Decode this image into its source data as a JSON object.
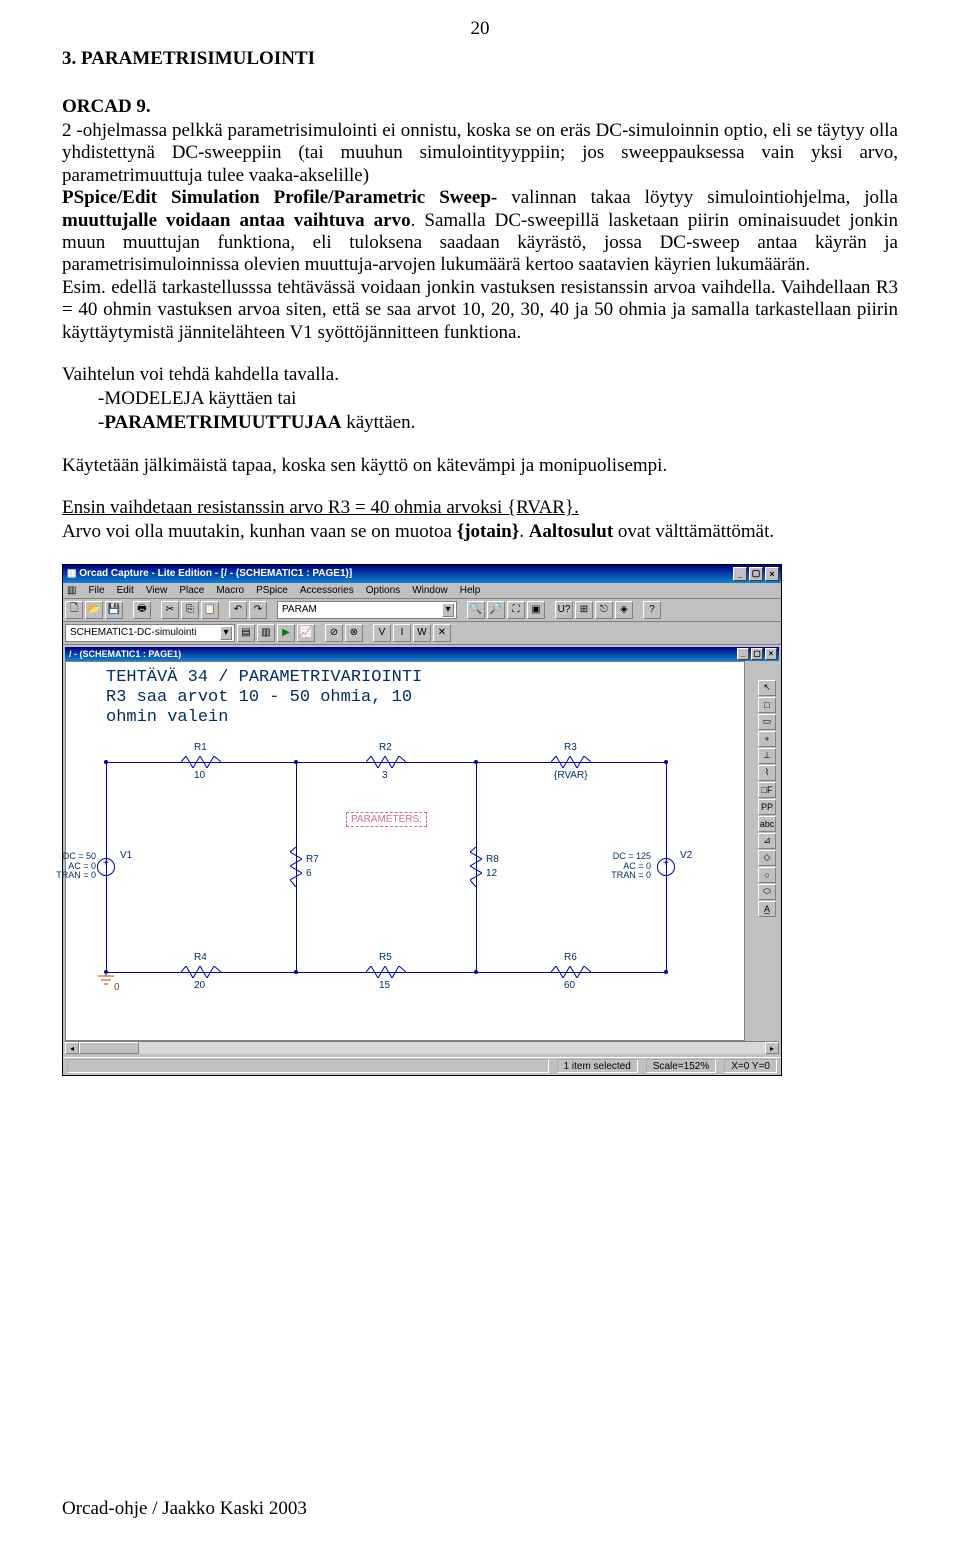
{
  "page_number": "20",
  "heading": "3. PARAMETRISIMULOINTI",
  "subheading": "ORCAD 9.",
  "para1_run1": "2 -ohjelmassa pelkkä parametrisimulointi ei onnistu, koska se on eräs DC-simuloinnin optio, eli se täytyy olla yhdistettynä DC-sweeppiin (tai muuhun simulointityyppiin; jos sweeppauksessa vain yksi arvo, parametrimuuttuja tulee vaaka-akselille)",
  "para1_run2_bold": "PSpice/Edit Simulation Profile/Parametric Sweep-",
  "para1_run3": " valinnan takaa löytyy simulointiohjelma, jolla ",
  "para1_run4_bold": "muuttujalle voidaan antaa vaihtuva arvo",
  "para1_run5": ". Samalla DC-sweepillä lasketaan piirin ominaisuudet jonkin muun muuttujan funktiona, eli tuloksena saadaan käyrästö, jossa DC-sweep antaa käyrän ja parametrisimuloinnissa olevien muuttuja-arvojen lukumäärä kertoo saatavien käyrien lukumäärän.",
  "para1_run6": "Esim. edellä tarkastellusssa tehtävässä voidaan jonkin vastuksen resistanssin arvoa vaihdella. Vaihdellaan R3 = 40 ohmin vastuksen arvoa siten, että se saa arvot 10, 20, 30, 40 ja 50 ohmia ja samalla tarkastellaan piirin käyttäytymistä jännitelähteen V1 syöttöjännitteen funktiona.",
  "para2": "Vaihtelun voi tehdä kahdella tavalla.",
  "para2_opt1_prefix": "-",
  "para2_opt1_bold": "MODELEJA",
  "para2_opt1_rest": " käyttäen  tai",
  "para2_opt2_prefix": "-",
  "para2_opt2_bold": "PARAMETRIMUUTTUJAA",
  "para2_opt2_rest": " käyttäen.",
  "para3": "Käytetään jälkimäistä tapaa, koska sen käyttö on kätevämpi ja monipuolisempi.",
  "para4_run1": "Ensin vaihdetaan resistanssin arvo R3 = 40 ohmia arvoksi ",
  "para4_run2_bold": "{RVAR}",
  "para4_run3": ".",
  "para5_run1": "Arvo voi olla muutakin, kunhan vaan se on muotoa ",
  "para5_run2_bold": "{jotain}",
  "para5_run3": ". ",
  "para5_run4_bold": "Aaltosulut",
  "para5_run5": " ovat välttämättömät.",
  "footer": "Orcad-ohje / Jaakko Kaski 2003",
  "orcad": {
    "title": "Orcad Capture - Lite Edition - [/ - (SCHEMATIC1 : PAGE1)]",
    "menus": [
      "File",
      "Edit",
      "View",
      "Place",
      "Macro",
      "PSpice",
      "Accessories",
      "Options",
      "Window",
      "Help"
    ],
    "combo1": "PARAM",
    "combo2": "SCHEMATIC1-DC-simulointi",
    "inner_title": "/ - (SCHEMATIC1 : PAGE1)",
    "sch_line1": "TEHTÄVÄ 34 / PARAMETRIVARIOINTI",
    "sch_line2": "R3 saa arvot 10 - 50 ohmia, 10",
    "sch_line3": "ohmin valein",
    "labels": {
      "R1": "R1",
      "R1v": "10",
      "R2": "R2",
      "R2v": "3",
      "R3": "R3",
      "R3v": "{RVAR}",
      "R4": "R4",
      "R4v": "20",
      "R5": "R5",
      "R5v": "15",
      "R6": "R6",
      "R6v": "60",
      "R7": "R7",
      "R7v": "6",
      "R8": "R8",
      "R8v": "12",
      "V1": "V1",
      "V2": "V2",
      "param": "PARAMETERS:",
      "src1_l1": "DC = 50",
      "src1_l2": "AC = 0",
      "src1_l3": "TRAN = 0",
      "src2_l1": "DC = 125",
      "src2_l2": "AC = 0",
      "src2_l3": "TRAN = 0"
    },
    "status": {
      "selected": "1 item selected",
      "scale": "Scale=152%",
      "coord": "X=0 Y=0"
    },
    "vtool_icons": [
      "↖",
      "□",
      "▭",
      "+",
      "⊥",
      "⌇",
      "□F",
      "PP",
      "abc",
      "⊿",
      "◇",
      "○",
      "⬭",
      "A̲"
    ]
  }
}
